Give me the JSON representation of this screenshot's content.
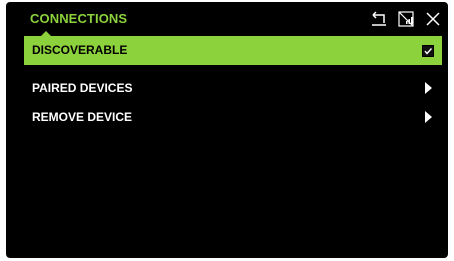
{
  "header": {
    "title": "CONNECTIONS",
    "icons": [
      "back-icon",
      "no-signal-icon",
      "close-icon"
    ]
  },
  "menu": {
    "items": [
      {
        "label": "DISCOVERABLE",
        "selected": true,
        "control": "checkbox",
        "checked": true
      },
      {
        "label": "PAIRED DEVICES",
        "selected": false,
        "control": "submenu-arrow"
      },
      {
        "label": "REMOVE DEVICE",
        "selected": false,
        "control": "submenu-arrow"
      }
    ]
  },
  "colors": {
    "accent": "#8cd23c",
    "background": "#000000",
    "text": "#ffffff"
  }
}
